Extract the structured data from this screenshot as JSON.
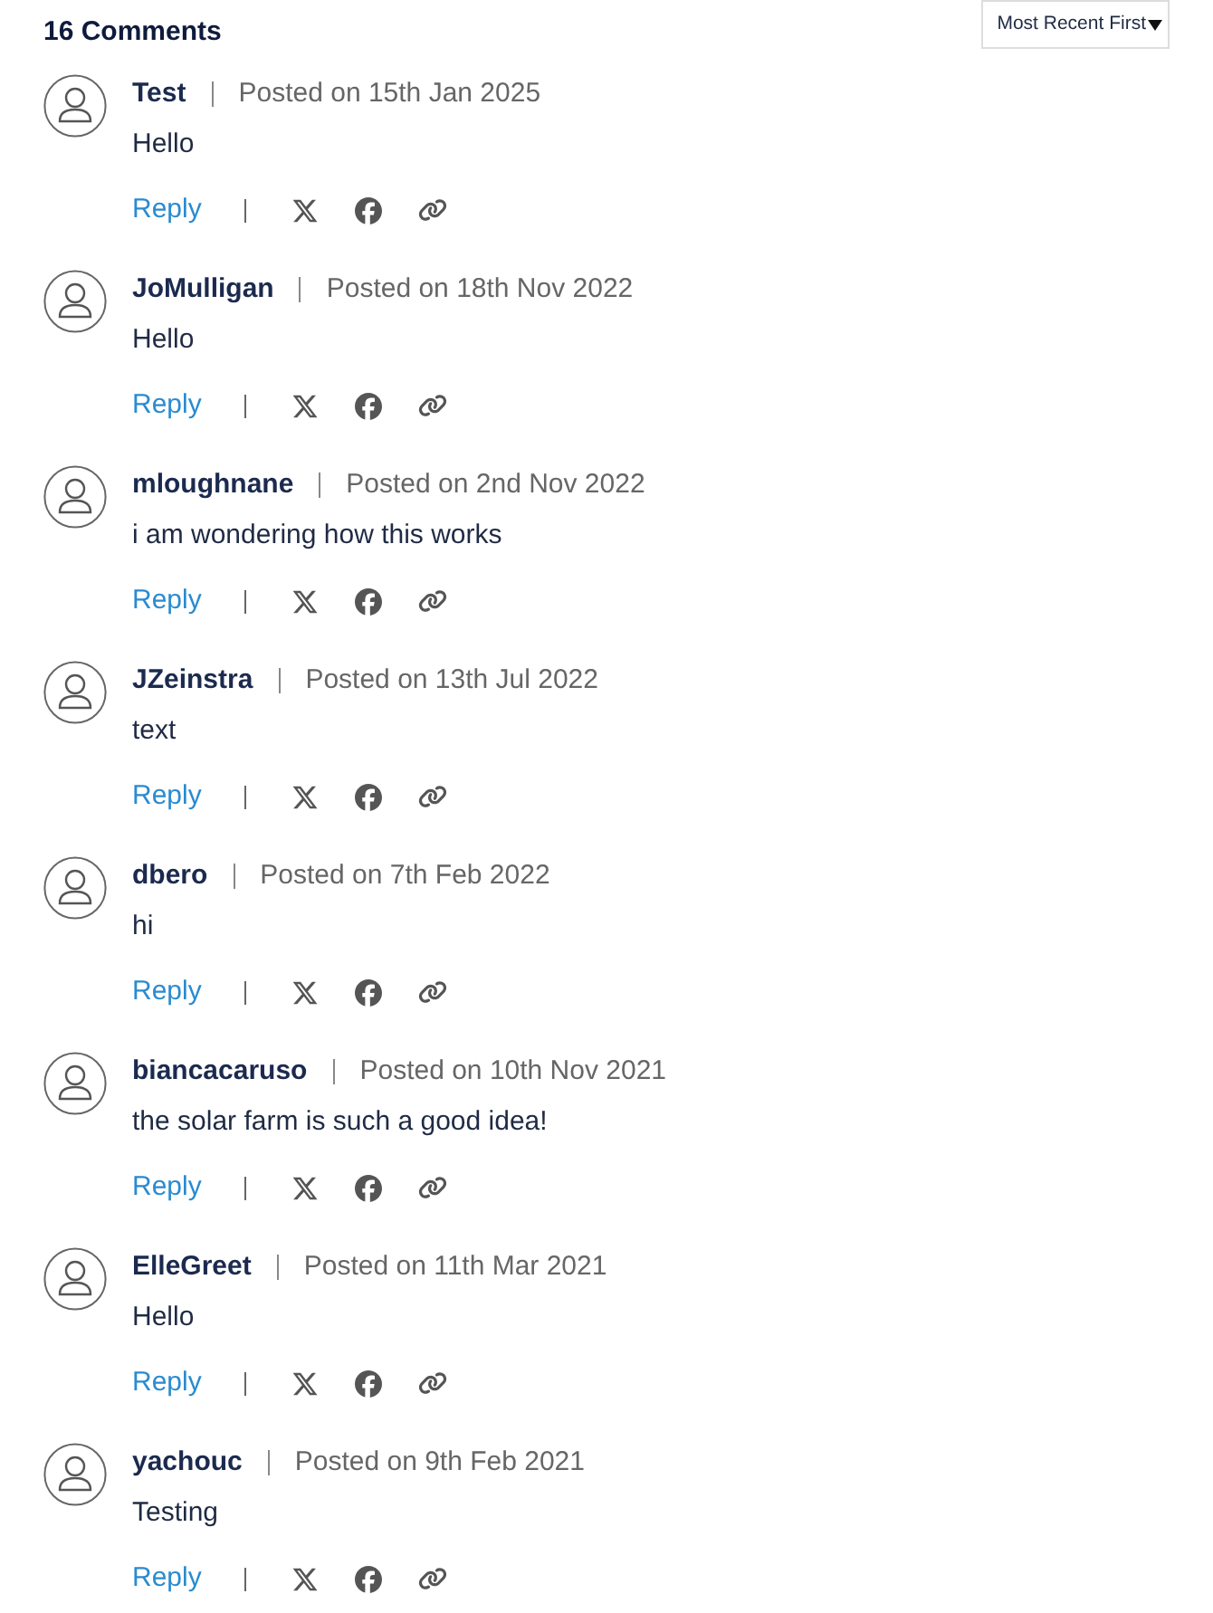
{
  "heading": "16 Comments",
  "sort": {
    "value": "Most Recent First"
  },
  "comments": [
    {
      "author": "Test",
      "date": "Posted on 15th Jan 2025",
      "text": "Hello",
      "reply": "Reply"
    },
    {
      "author": "JoMulligan",
      "date": "Posted on 18th Nov 2022",
      "text": "Hello",
      "reply": "Reply"
    },
    {
      "author": "mloughnane",
      "date": "Posted on 2nd Nov 2022",
      "text": "i am wondering how this works",
      "reply": "Reply"
    },
    {
      "author": "JZeinstra",
      "date": "Posted on 13th Jul 2022",
      "text": "text",
      "reply": "Reply"
    },
    {
      "author": "dbero",
      "date": "Posted on 7th Feb 2022",
      "text": "hi",
      "reply": "Reply"
    },
    {
      "author": "biancacaruso",
      "date": "Posted on 10th Nov 2021",
      "text": "the solar farm is such a good idea!",
      "reply": "Reply"
    },
    {
      "author": "ElleGreet",
      "date": "Posted on 11th Mar 2021",
      "text": "Hello",
      "reply": "Reply"
    },
    {
      "author": "yachouc",
      "date": "Posted on 9th Feb 2021",
      "text": "Testing",
      "reply": "Reply"
    }
  ]
}
